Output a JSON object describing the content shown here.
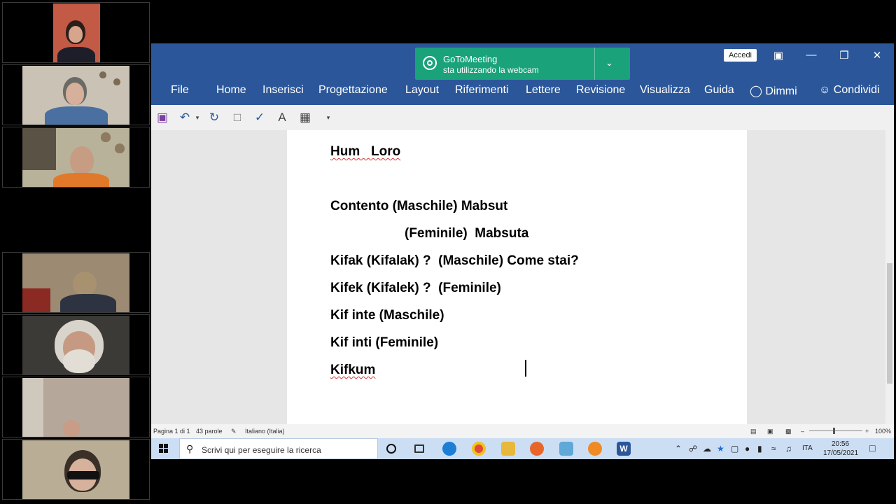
{
  "notification": {
    "app": "GoToMeeting",
    "message": "sta utilizzando la webcam"
  },
  "window": {
    "signin": "Accedi"
  },
  "menu": {
    "file": "File",
    "home": "Home",
    "insert": "Inserisci",
    "design": "Progettazione",
    "layout": "Layout",
    "references": "Riferimenti",
    "mailings": "Lettere",
    "review": "Revisione",
    "view": "Visualizza",
    "help": "Guida",
    "tellme": "Dimmi",
    "share": "Condividi"
  },
  "document": {
    "lines": [
      "Hum   Loro",
      "Contento (Maschile) Mabsut",
      "(Feminile)  Mabsuta",
      "Kifak (Kifalak) ?  (Maschile) Come stai?",
      "Kifek (Kifalek) ?  (Feminile)",
      "Kif inte (Maschile)",
      "Kif inti (Feminile)",
      "Kifkum"
    ]
  },
  "statusbar": {
    "page": "Pagina 1 di 1",
    "words": "43 parole",
    "language": "Italiano (Italia)",
    "zoom": "100%"
  },
  "taskbar": {
    "search_placeholder": "Scrivi qui per eseguire la ricerca",
    "lang": "ITA",
    "time": "20:56",
    "date": "17/05/2021"
  }
}
